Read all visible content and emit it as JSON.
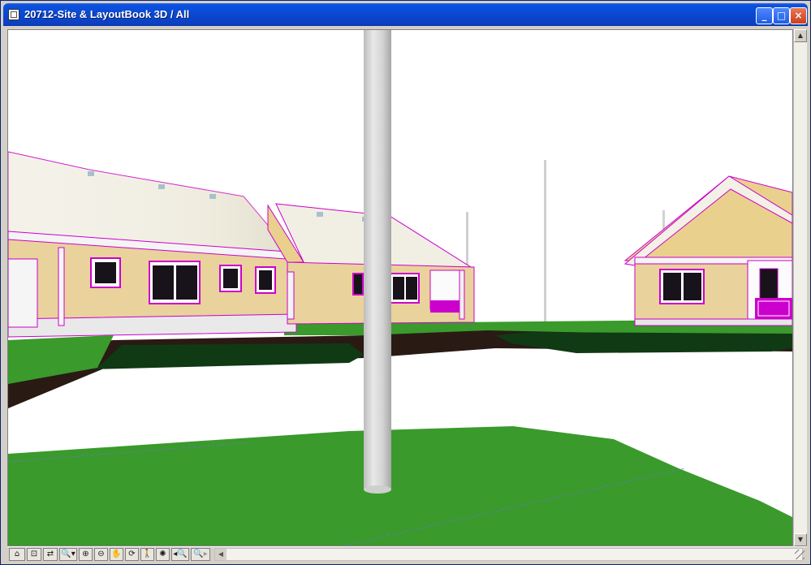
{
  "window": {
    "title": "20712-Site & LayoutBook 3D / All",
    "controls": {
      "minimize": "_",
      "maximize": "□",
      "close": "×"
    }
  },
  "scene": {
    "view": "3D perspective",
    "colors": {
      "sky": "#ffffff",
      "grass": "#3a9a2c",
      "grass_dark": "#0f3a14",
      "soil": "#2a1a14",
      "wall": "#e9d29c",
      "roof": "#f4f2e6",
      "edge_highlight": "#cc00cc",
      "pole": "#d8d8d8"
    }
  },
  "toolbar": {
    "icons": [
      {
        "name": "navigation-mode-icon",
        "glyph": "⌂"
      },
      {
        "name": "fit-in-window-icon",
        "glyph": "⊡"
      },
      {
        "name": "previous-view-icon",
        "glyph": "⇄"
      },
      {
        "name": "zoom-dropdown-icon",
        "glyph": "🔍▾"
      },
      {
        "name": "zoom-in-icon",
        "glyph": "⊕"
      },
      {
        "name": "zoom-out-icon",
        "glyph": "⊖"
      },
      {
        "name": "pan-icon",
        "glyph": "✋"
      },
      {
        "name": "orbit-icon",
        "glyph": "⟳"
      },
      {
        "name": "walk-icon",
        "glyph": "🚶"
      },
      {
        "name": "explore-icon",
        "glyph": "✺"
      },
      {
        "name": "previous-zoom-icon",
        "glyph": "◂🔍"
      },
      {
        "name": "next-zoom-icon",
        "glyph": "🔍▸"
      }
    ]
  }
}
